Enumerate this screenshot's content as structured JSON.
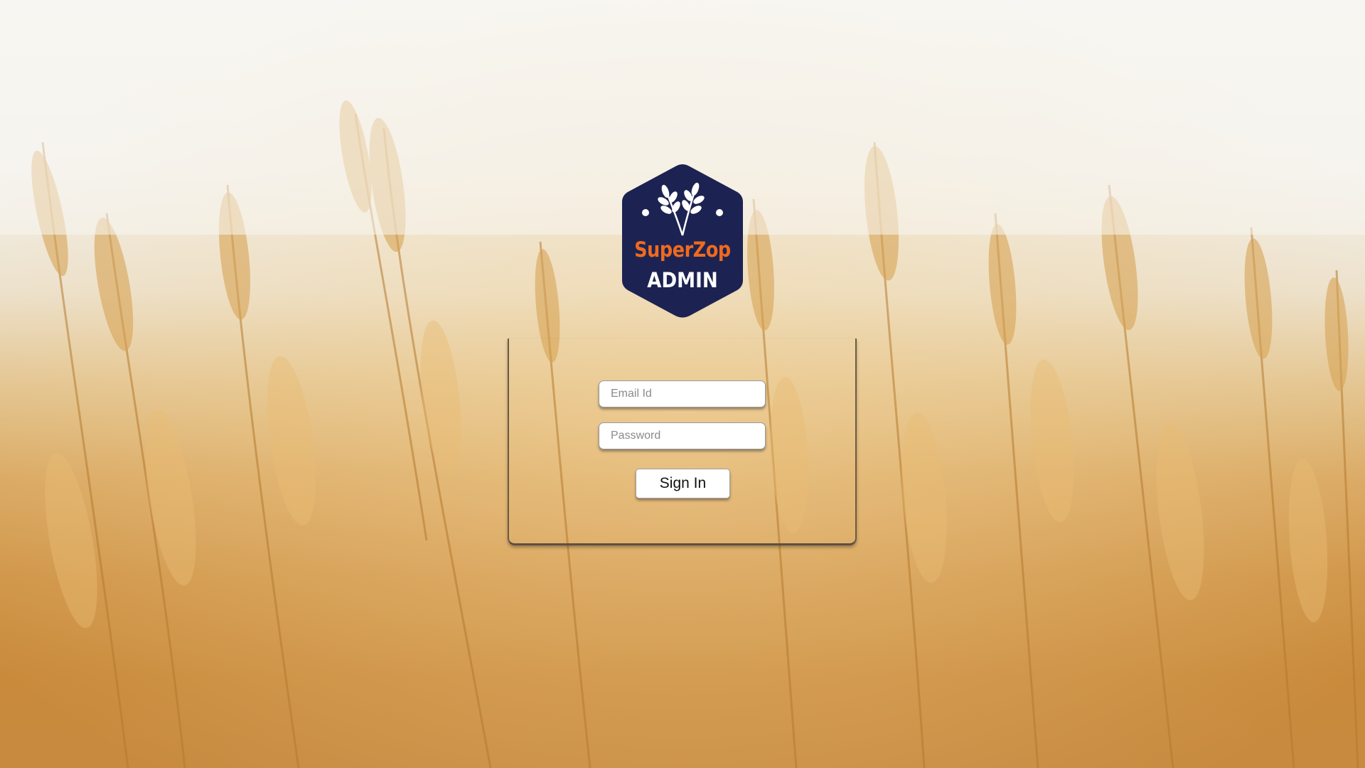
{
  "logo": {
    "brand": "SuperZop",
    "subtitle": "ADMIN",
    "icon": "wheat-icon",
    "shape_color": "#1c2352",
    "brand_color": "#ef6a1f"
  },
  "login": {
    "email_placeholder": "Email Id",
    "email_value": "",
    "password_placeholder": "Password",
    "password_value": "",
    "signin_label": "Sign In"
  },
  "background": {
    "description_icon": "wheat-field-background"
  }
}
